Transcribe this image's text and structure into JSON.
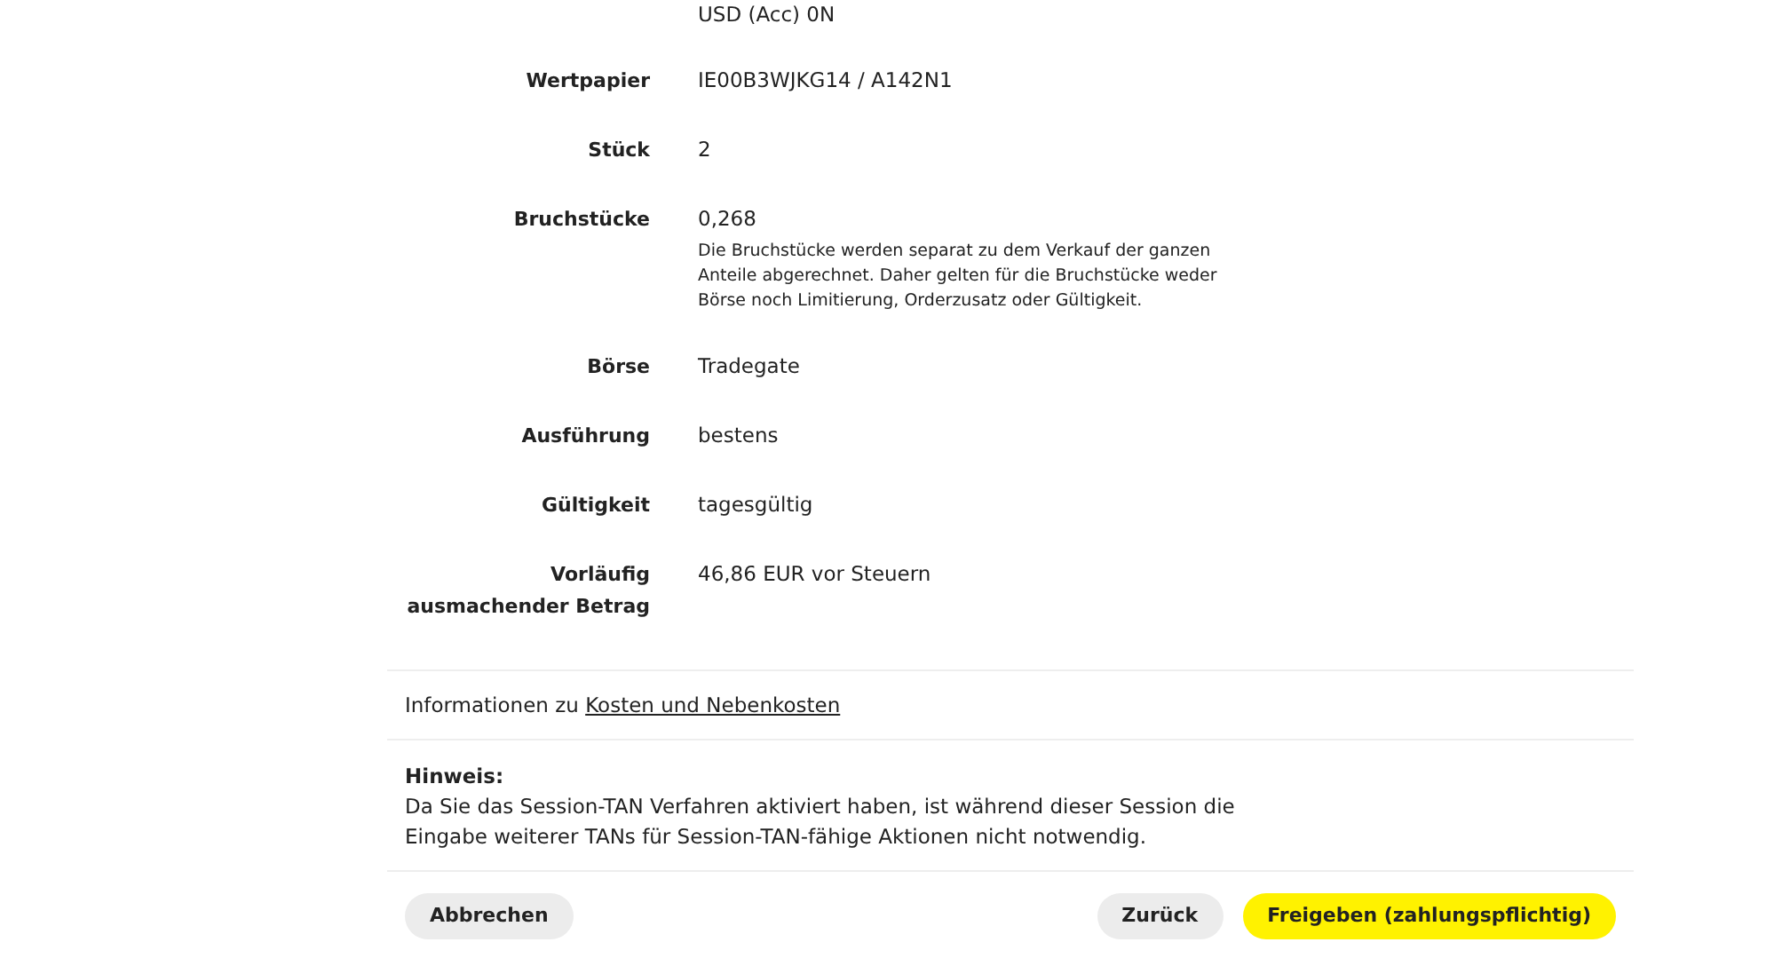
{
  "details": [
    {
      "value": "USD (Acc) 0N"
    },
    {
      "label": "Wertpapier",
      "value": "IE00B3WJKG14 / A142N1"
    },
    {
      "label": "Stück",
      "value": "2"
    },
    {
      "label": "Bruchstücke",
      "value": "0,268",
      "note": "Die Bruchstücke werden separat zu dem Verkauf der ganzen Anteile abgerechnet. Daher gelten für die Bruchstücke weder Börse noch Limitierung, Orderzusatz oder Gültigkeit."
    },
    {
      "label": "Börse",
      "value": "Tradegate"
    },
    {
      "label": "Ausführung",
      "value": "bestens"
    },
    {
      "label": "Gültigkeit",
      "value": "tagesgültig"
    },
    {
      "label": "Vorläufig ausmachender Betrag",
      "value": "46,86 EUR vor Steuern"
    }
  ],
  "cost_info": {
    "text": "Informationen zu",
    "link": "Kosten und Nebenkosten"
  },
  "notice": {
    "title": "Hinweis:",
    "text": "Da Sie das Session-TAN Verfahren aktiviert haben, ist während dieser Session die Eingabe weiterer TANs für Session-TAN-fähige Aktionen nicht notwendig."
  },
  "buttons": [
    {
      "label": "Abbrechen",
      "kind": "secondary"
    },
    {
      "kind": "spacer"
    },
    {
      "label": "Zurück",
      "kind": "secondary"
    },
    {
      "label": "Freigeben (zahlungspflichtig)",
      "kind": "primary"
    }
  ]
}
